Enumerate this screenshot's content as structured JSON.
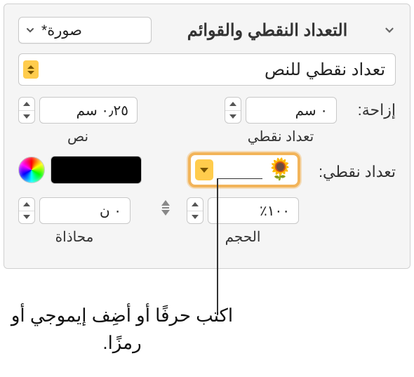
{
  "section": {
    "title": "التعداد النقطي والقوائم",
    "style_dropdown": "صورة*"
  },
  "list_type": "تعداد نقطي للنص",
  "indent": {
    "label": "إزاحة:",
    "bullet": {
      "value": "٠ سم",
      "caption": "تعداد نقطي"
    },
    "text": {
      "value": "٠٫٢٥ سم",
      "caption": "نص"
    }
  },
  "bullet": {
    "label": "تعداد نقطي:",
    "glyph": "🌻"
  },
  "size": {
    "value": "١٠٠٪",
    "caption": "الحجم"
  },
  "align": {
    "value": "٠ ن",
    "caption": "محاذاة"
  },
  "callout": "اكتب حرفًا أو أضِف إيموجي أو رمزًا."
}
